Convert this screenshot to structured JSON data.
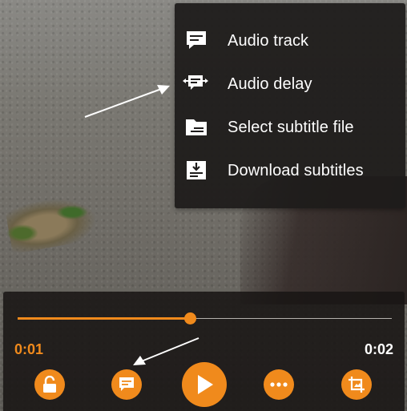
{
  "menu": {
    "items": [
      {
        "label": "Audio track",
        "icon": "audio-track-icon"
      },
      {
        "label": "Audio delay",
        "icon": "audio-delay-icon"
      },
      {
        "label": "Select subtitle file",
        "icon": "folder-subtitle-icon"
      },
      {
        "label": "Download subtitles",
        "icon": "download-subtitles-icon"
      }
    ]
  },
  "player": {
    "time_elapsed": "0:01",
    "time_total": "0:02",
    "progress_fraction": 0.46,
    "buttons": [
      {
        "name": "lock-button",
        "icon": "lock-icon"
      },
      {
        "name": "subtitles-button",
        "icon": "subtitles-icon"
      },
      {
        "name": "play-button",
        "icon": "play-icon"
      },
      {
        "name": "more-options-button",
        "icon": "more-horizontal-icon"
      },
      {
        "name": "crop-button",
        "icon": "crop-icon"
      }
    ]
  },
  "colors": {
    "accent": "#f08a1c",
    "menu_bg": "#1e1c1b",
    "text": "#ffffff"
  }
}
